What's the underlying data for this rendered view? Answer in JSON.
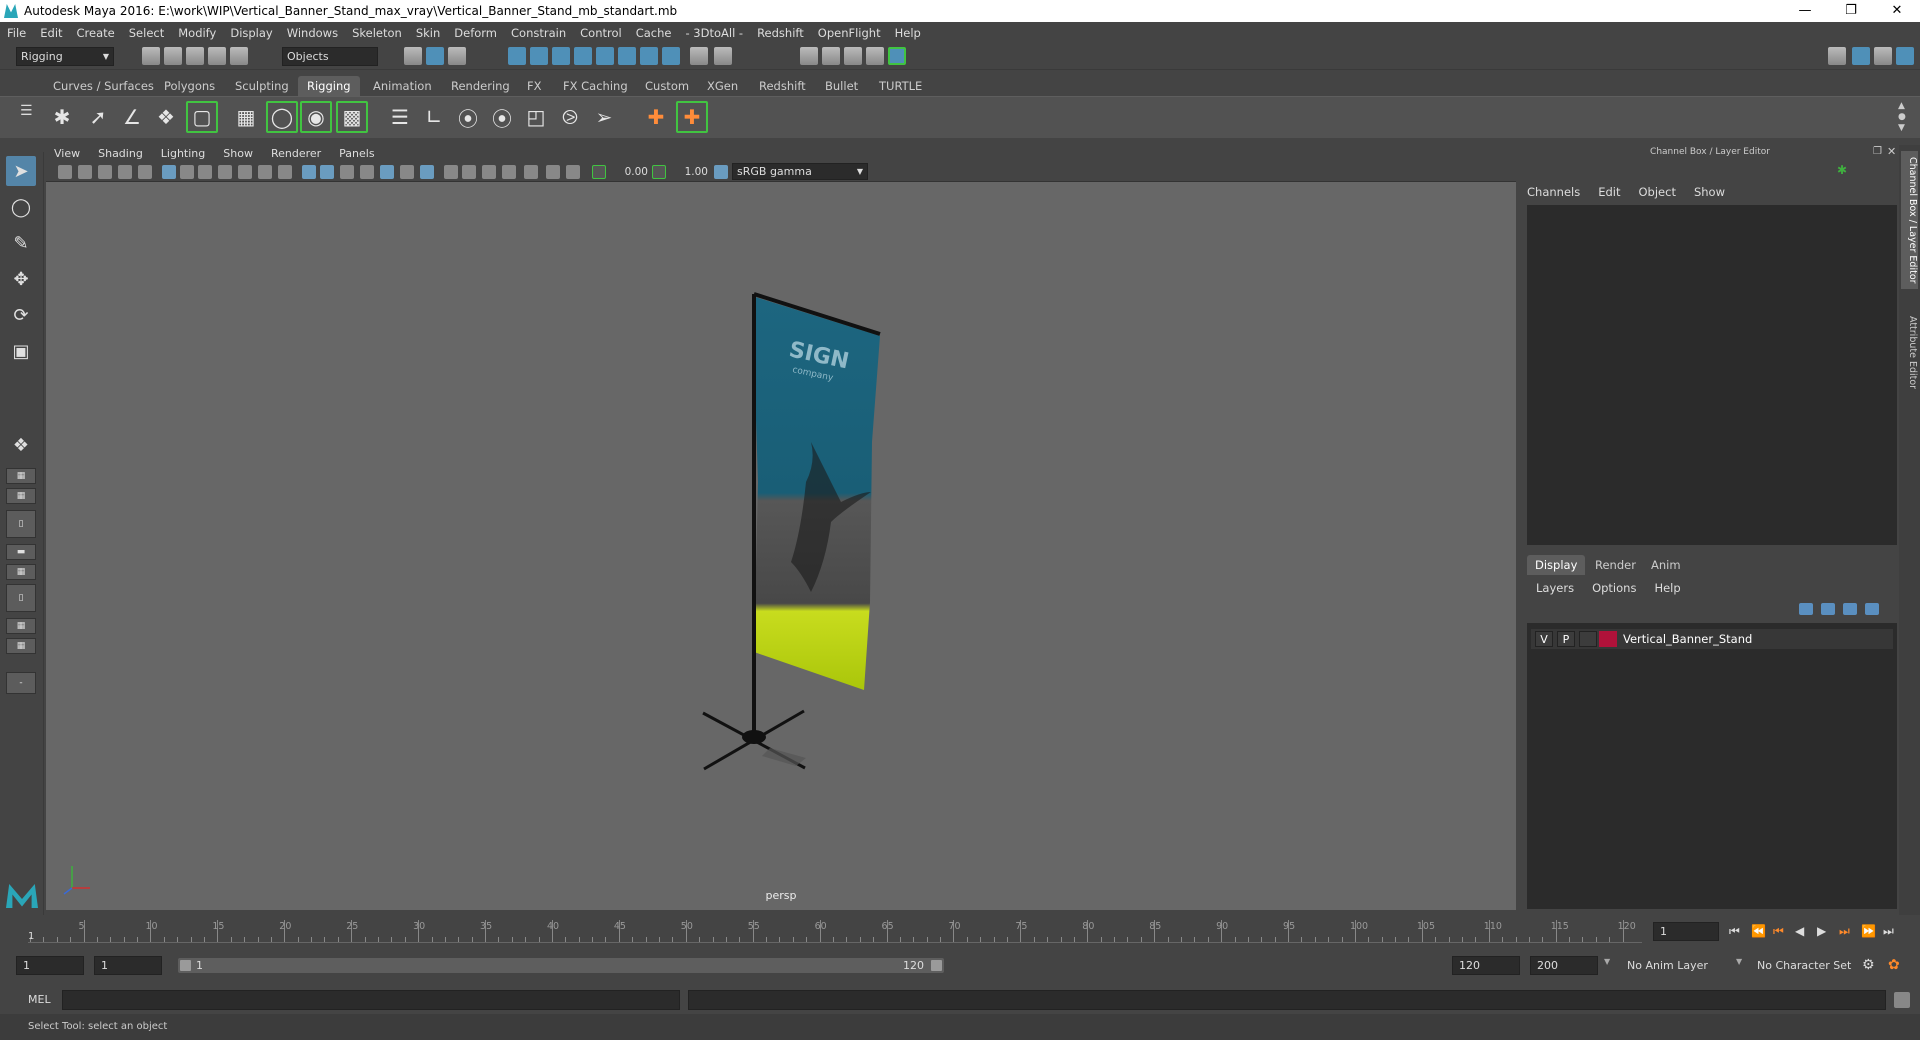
{
  "window": {
    "title": "Autodesk Maya 2016: E:\\work\\WIP\\Vertical_Banner_Stand_max_vray\\Vertical_Banner_Stand_mb_standart.mb"
  },
  "menubar": [
    "File",
    "Edit",
    "Create",
    "Select",
    "Modify",
    "Display",
    "Windows",
    "Skeleton",
    "Skin",
    "Deform",
    "Constrain",
    "Control",
    "Cache",
    "- 3DtoAll -",
    "Redshift",
    "OpenFlight",
    "Help"
  ],
  "statusline": {
    "mode": "Rigging",
    "selection_mode": "Objects"
  },
  "shelf_tabs": [
    "Curves / Surfaces",
    "Polygons",
    "Sculpting",
    "Rigging",
    "Animation",
    "Rendering",
    "FX",
    "FX Caching",
    "Custom",
    "XGen",
    "Redshift",
    "Bullet",
    "TURTLE"
  ],
  "active_shelf": "Rigging",
  "panel_menu": [
    "View",
    "Shading",
    "Lighting",
    "Show",
    "Renderer",
    "Panels"
  ],
  "panel_toolbar": {
    "exposure": "0.00",
    "gamma": "1.00",
    "color_space": "sRGB gamma"
  },
  "viewport": {
    "camera": "persp",
    "banner_text": "SIGN",
    "banner_subtext": "company"
  },
  "channel_box": {
    "title": "Channel Box / Layer Editor",
    "menu": [
      "Channels",
      "Edit",
      "Object",
      "Show"
    ],
    "tabs": [
      "Display",
      "Render",
      "Anim"
    ],
    "active_tab": "Display",
    "layer_menu": [
      "Layers",
      "Options",
      "Help"
    ],
    "layers": [
      {
        "v": "V",
        "p": "P",
        "color": "#b0123a",
        "name": "Vertical_Banner_Stand"
      }
    ]
  },
  "side_tabs": [
    "Channel Box / Layer Editor",
    "Attribute Editor"
  ],
  "timeline": {
    "ticks": [
      "5",
      "10",
      "15",
      "20",
      "25",
      "30",
      "35",
      "40",
      "45",
      "50",
      "55",
      "60",
      "65",
      "70",
      "75",
      "80",
      "85",
      "90",
      "95",
      "100",
      "105",
      "110",
      "115",
      "120"
    ],
    "start_label": "1",
    "current_frame": "1"
  },
  "range": {
    "start": "1",
    "playback_start": "1",
    "slider_start": "1",
    "slider_end": "120",
    "playback_end": "120",
    "end": "200",
    "anim_layer": "No Anim Layer",
    "character_set": "No Character Set"
  },
  "cmdline": {
    "label": "MEL"
  },
  "helpline": {
    "text": "Select Tool: select an object"
  }
}
